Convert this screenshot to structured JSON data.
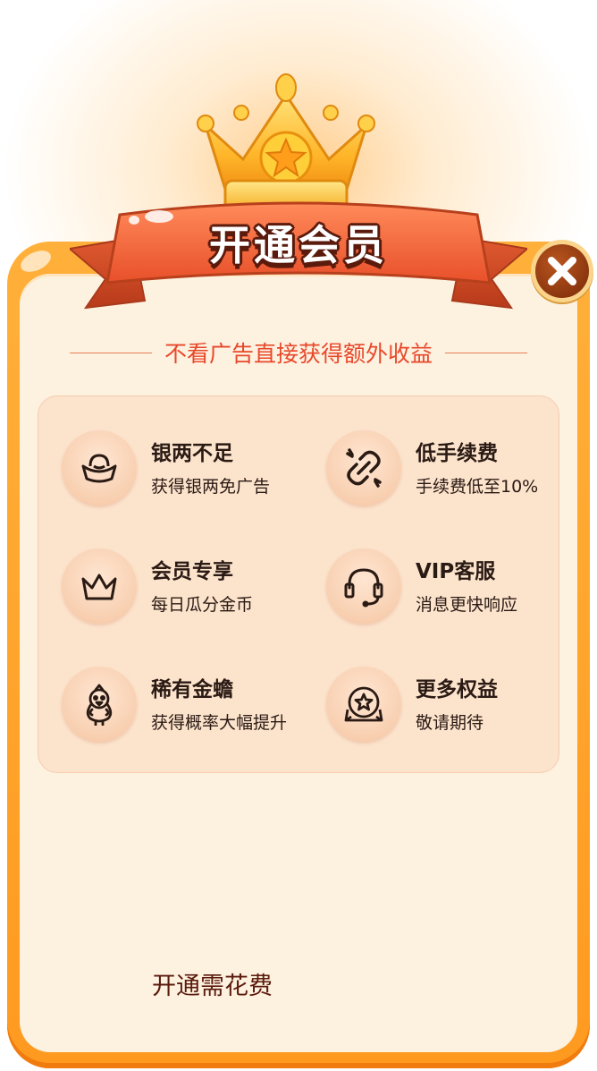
{
  "header": {
    "title": "开通会员",
    "close_icon": "close-icon"
  },
  "subtitle": "不看广告直接获得额外收益",
  "benefits": [
    {
      "title": "银两不足",
      "desc": "获得银两免广告",
      "icon": "silver-ingot-icon"
    },
    {
      "title": "低手续费",
      "desc": "手续费低至10%",
      "icon": "broken-link-icon"
    },
    {
      "title": "会员专享",
      "desc": "每日瓜分金币",
      "icon": "crown-icon"
    },
    {
      "title": "VIP客服",
      "desc": "消息更快响应",
      "icon": "headset-icon"
    },
    {
      "title": "稀有金蟾",
      "desc": "获得概率大幅提升",
      "icon": "chick-icon"
    },
    {
      "title": "更多权益",
      "desc": "敬请期待",
      "icon": "star-badge-icon"
    }
  ],
  "footer": {
    "cost_label": "开通需花费"
  },
  "colors": {
    "panel_orange": "#ffa52e",
    "panel_cream": "#fdf1e0",
    "subtitle_red": "#e8482a",
    "benefit_bg": "#fce3cc",
    "text_dark": "#2a1a14"
  }
}
